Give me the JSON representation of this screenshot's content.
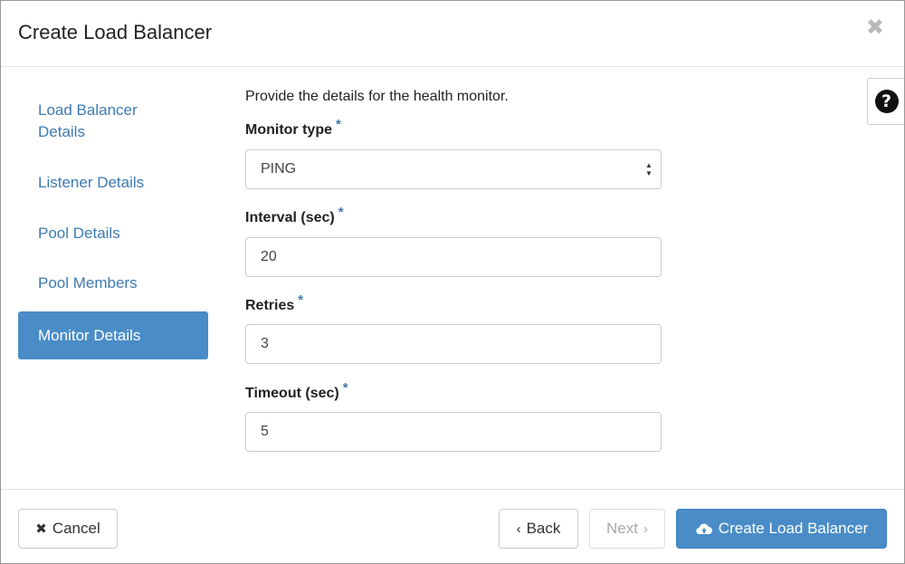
{
  "header": {
    "title": "Create Load Balancer",
    "close_glyph": "✖"
  },
  "nav": {
    "items": [
      {
        "label": "Load Balancer Details"
      },
      {
        "label": "Listener Details"
      },
      {
        "label": "Pool Details"
      },
      {
        "label": "Pool Members"
      },
      {
        "label": "Monitor Details",
        "active": true
      }
    ]
  },
  "help": {
    "glyph": "?"
  },
  "form": {
    "intro": "Provide the details for the health monitor.",
    "required_marker": "*",
    "monitor_type": {
      "label": "Monitor type",
      "value": "PING"
    },
    "interval": {
      "label": "Interval (sec)",
      "value": "20"
    },
    "retries": {
      "label": "Retries",
      "value": "3"
    },
    "timeout": {
      "label": "Timeout (sec)",
      "value": "5"
    }
  },
  "footer": {
    "cancel_label": "Cancel",
    "back_label": "Back",
    "next_label": "Next",
    "create_label": "Create Load Balancer"
  },
  "colors": {
    "accent": "#4a8cc7",
    "link": "#3d7ab2"
  }
}
